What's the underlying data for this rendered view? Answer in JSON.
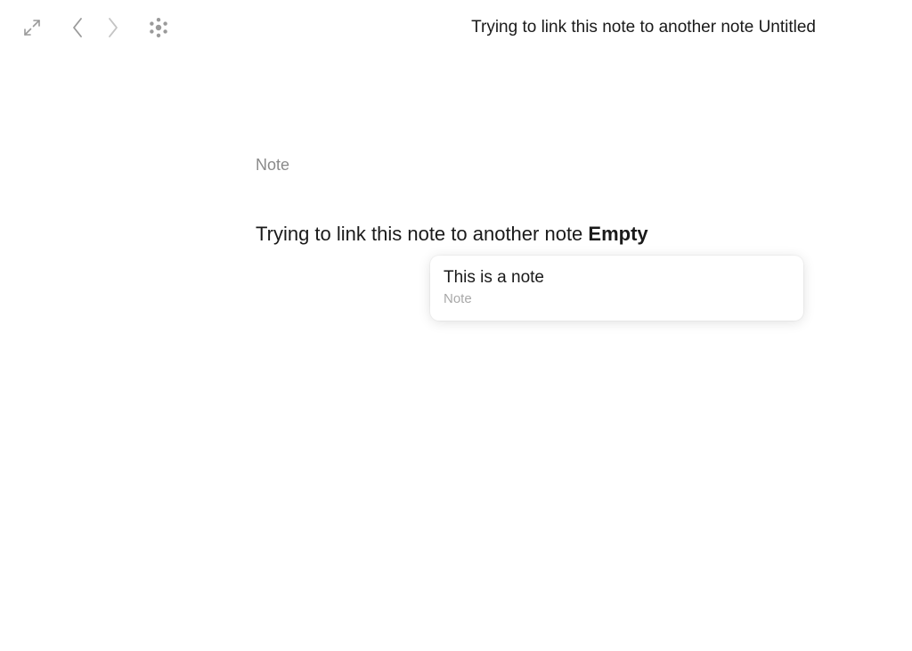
{
  "toolbar": {
    "expand_icon": "expand-arrows-icon",
    "back_icon": "chevron-left-icon",
    "forward_icon": "chevron-right-icon",
    "graph_icon": "graph-dots-icon"
  },
  "window": {
    "title": "Trying to link this note to another note Untitled"
  },
  "document": {
    "type_label": "Note",
    "body_text": "Trying to link this note to another note",
    "link_text": "Empty"
  },
  "link_popover": {
    "title": "This is a note",
    "subtitle": "Note"
  },
  "colors": {
    "text": "#1a1a1a",
    "muted": "#8a8a8a",
    "icon": "#9a9a9a",
    "icon_disabled": "#c4c4c4",
    "background": "#ffffff"
  }
}
